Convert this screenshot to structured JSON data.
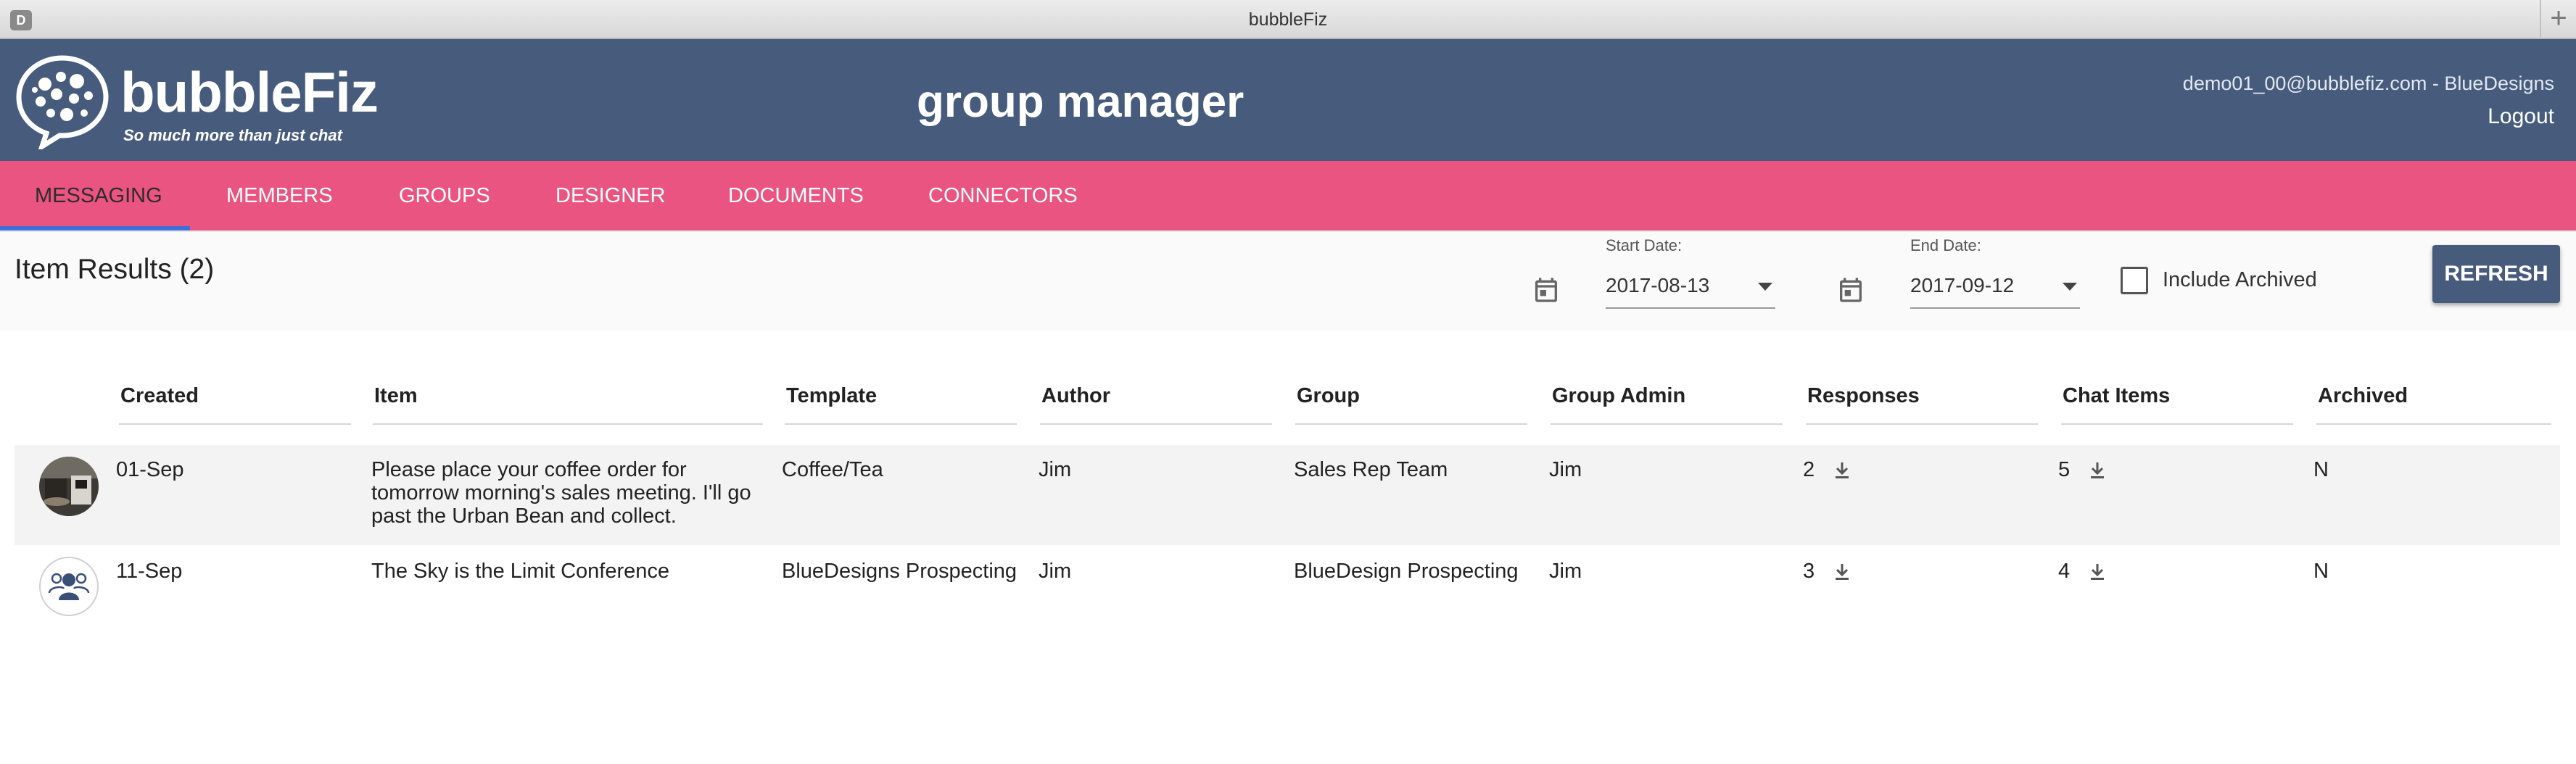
{
  "browser": {
    "tab_icon": "D",
    "title": "bubbleFiz",
    "new_tab": "+"
  },
  "header": {
    "brand": "bubbleFiz",
    "tagline": "So much more than just chat",
    "app_title": "group manager",
    "user": "demo01_00@bubblefiz.com - BlueDesigns",
    "logout": "Logout"
  },
  "nav": {
    "items": [
      "MESSAGING",
      "MEMBERS",
      "GROUPS",
      "DESIGNER",
      "DOCUMENTS",
      "CONNECTORS"
    ],
    "active": "MESSAGING"
  },
  "filter": {
    "results_title": "Item Results (2)",
    "start_label": "Start Date:",
    "start_value": "2017-08-13",
    "end_label": "End Date:",
    "end_value": "2017-09-12",
    "include_archived_label": "Include Archived",
    "include_archived_checked": false,
    "refresh_label": "REFRESH"
  },
  "table": {
    "columns": [
      "Created",
      "Item",
      "Template",
      "Author",
      "Group",
      "Group Admin",
      "Responses",
      "Chat Items",
      "Archived"
    ],
    "rows": [
      {
        "avatar": "coffee-photo-avatar",
        "created": "01-Sep",
        "item_lines": [
          "Please place your coffee order for",
          "tomorrow morning's sales meeting. I'll go",
          "past the Urban Bean and collect."
        ],
        "template": "Coffee/Tea",
        "author": "Jim",
        "group": "Sales Rep Team",
        "group_admin": "Jim",
        "responses": "2",
        "chat_items": "5",
        "archived": "N"
      },
      {
        "avatar": "group-people-avatar",
        "created": "11-Sep",
        "item_lines": [
          "The Sky is the Limit Conference"
        ],
        "template": "BlueDesigns Prospecting",
        "author": "Jim",
        "group": "BlueDesign Prospecting",
        "group_admin": "Jim",
        "responses": "3",
        "chat_items": "4",
        "archived": "N"
      }
    ]
  },
  "icons": {
    "calendar": "calendar-icon",
    "caret": "caret-down-icon",
    "download": "download-icon"
  },
  "colors": {
    "header_bg": "#475c7d",
    "nav_bg": "#ea5480",
    "active_underline": "#3f6fd8",
    "refresh_bg": "#475c7d"
  }
}
